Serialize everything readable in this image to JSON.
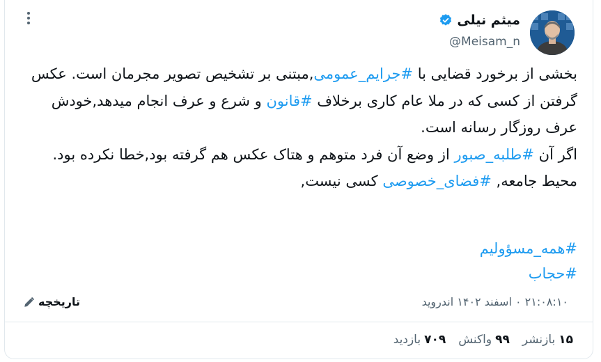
{
  "author": {
    "name": "میثم نیلی",
    "handle": "@Meisam_n",
    "verified_color": "#1d9bf0"
  },
  "tweet": {
    "p1": [
      {
        "t": "بخشی از برخورد قضایی با "
      },
      {
        "t": "#جرایم_عمومی",
        "tag": true
      },
      {
        "t": ",مبتنی بر تشخیص تصویر مجرمان است. عکس گرفتن از کسی که در ملا عام کاری برخلاف "
      },
      {
        "t": "#قانون",
        "tag": true
      },
      {
        "t": " و شرع و عرف انجام میدهد,خودش عرف روزگار رسانه است."
      }
    ],
    "p2": [
      {
        "t": "اگر آن "
      },
      {
        "t": "#طلبه_صبور",
        "tag": true
      },
      {
        "t": " از وضع آن فرد متوهم و هتاک عکس هم گرفته بود,خطا نکرده بود."
      }
    ],
    "p3": [
      {
        "t": "محیط جامعه, "
      },
      {
        "t": "#فضای_خصوصی",
        "tag": true
      },
      {
        "t": " کسی نیست,"
      }
    ],
    "hashtags": [
      "#همه_مسؤولیم",
      "#حجاب"
    ]
  },
  "meta": {
    "timestamp": "۲۱:۰۸:۱۰ ۰ اسفند ۱۴۰۲ اندروید",
    "history_label": "تاریخچه"
  },
  "stats": {
    "reposts_value": "۱۵",
    "reposts_label": "بازنشر",
    "reactions_value": "۹۹",
    "reactions_label": "واکنش",
    "views_value": "۷۰۹",
    "views_label": "بازدید"
  },
  "colors": {
    "accent": "#1d9bf0",
    "muted": "#536471",
    "text": "#0f1419"
  }
}
